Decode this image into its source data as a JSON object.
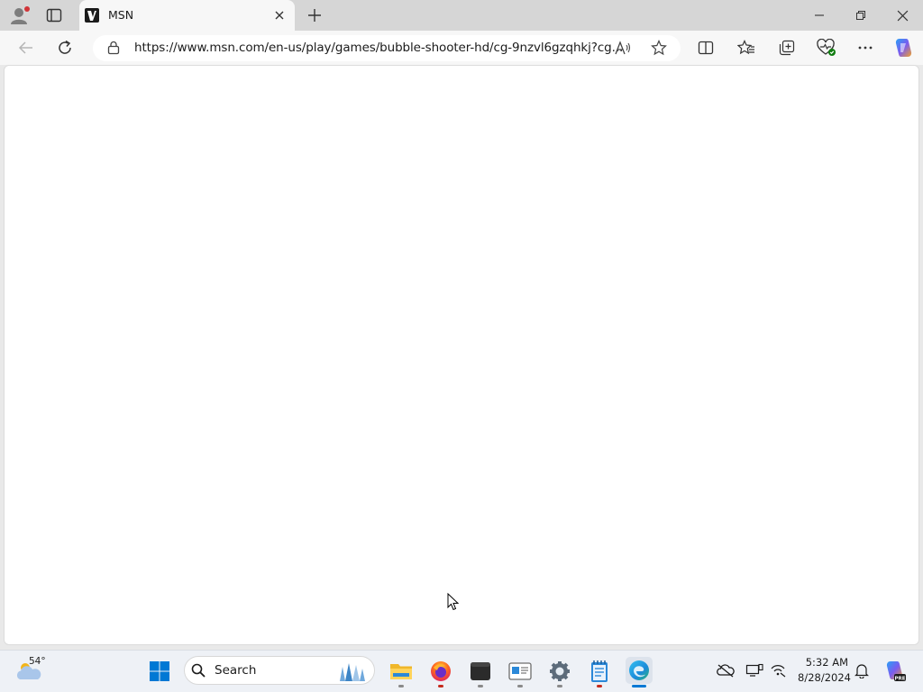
{
  "browser": {
    "tab": {
      "title": "MSN"
    },
    "address_bar": {
      "url": "https://www.msn.com/en-us/play/games/bubble-shooter-hd/cg-9nzvl6gzqhkj?cg..."
    }
  },
  "taskbar": {
    "weather": {
      "temperature": "54°"
    },
    "search": {
      "label": "Search"
    },
    "clock": {
      "time": "5:32 AM",
      "date": "8/28/2024"
    },
    "colors": {
      "accent": "#0067c0",
      "edge_indicator": "#0078d4",
      "firefox_indicator": "#c42b1c"
    }
  },
  "icons": [
    "profile-icon",
    "workspaces-icon",
    "msn-favicon",
    "close-tab-icon",
    "new-tab-icon",
    "minimize-icon",
    "restore-icon",
    "close-window-icon",
    "back-icon",
    "refresh-icon",
    "lock-icon",
    "read-aloud-icon",
    "favorite-star-icon",
    "split-screen-icon",
    "favorites-icon",
    "collections-icon",
    "browser-essentials-icon",
    "more-icon",
    "copilot-icon",
    "weather-icon",
    "windows-start-icon",
    "search-icon",
    "file-explorer-icon",
    "firefox-icon",
    "terminal-icon",
    "app-icon",
    "settings-icon",
    "notepad-icon",
    "edge-icon",
    "onedrive-icon",
    "display-icon",
    "network-icon",
    "notification-bell-icon",
    "copilot-pre-icon",
    "mouse-cursor-icon"
  ]
}
